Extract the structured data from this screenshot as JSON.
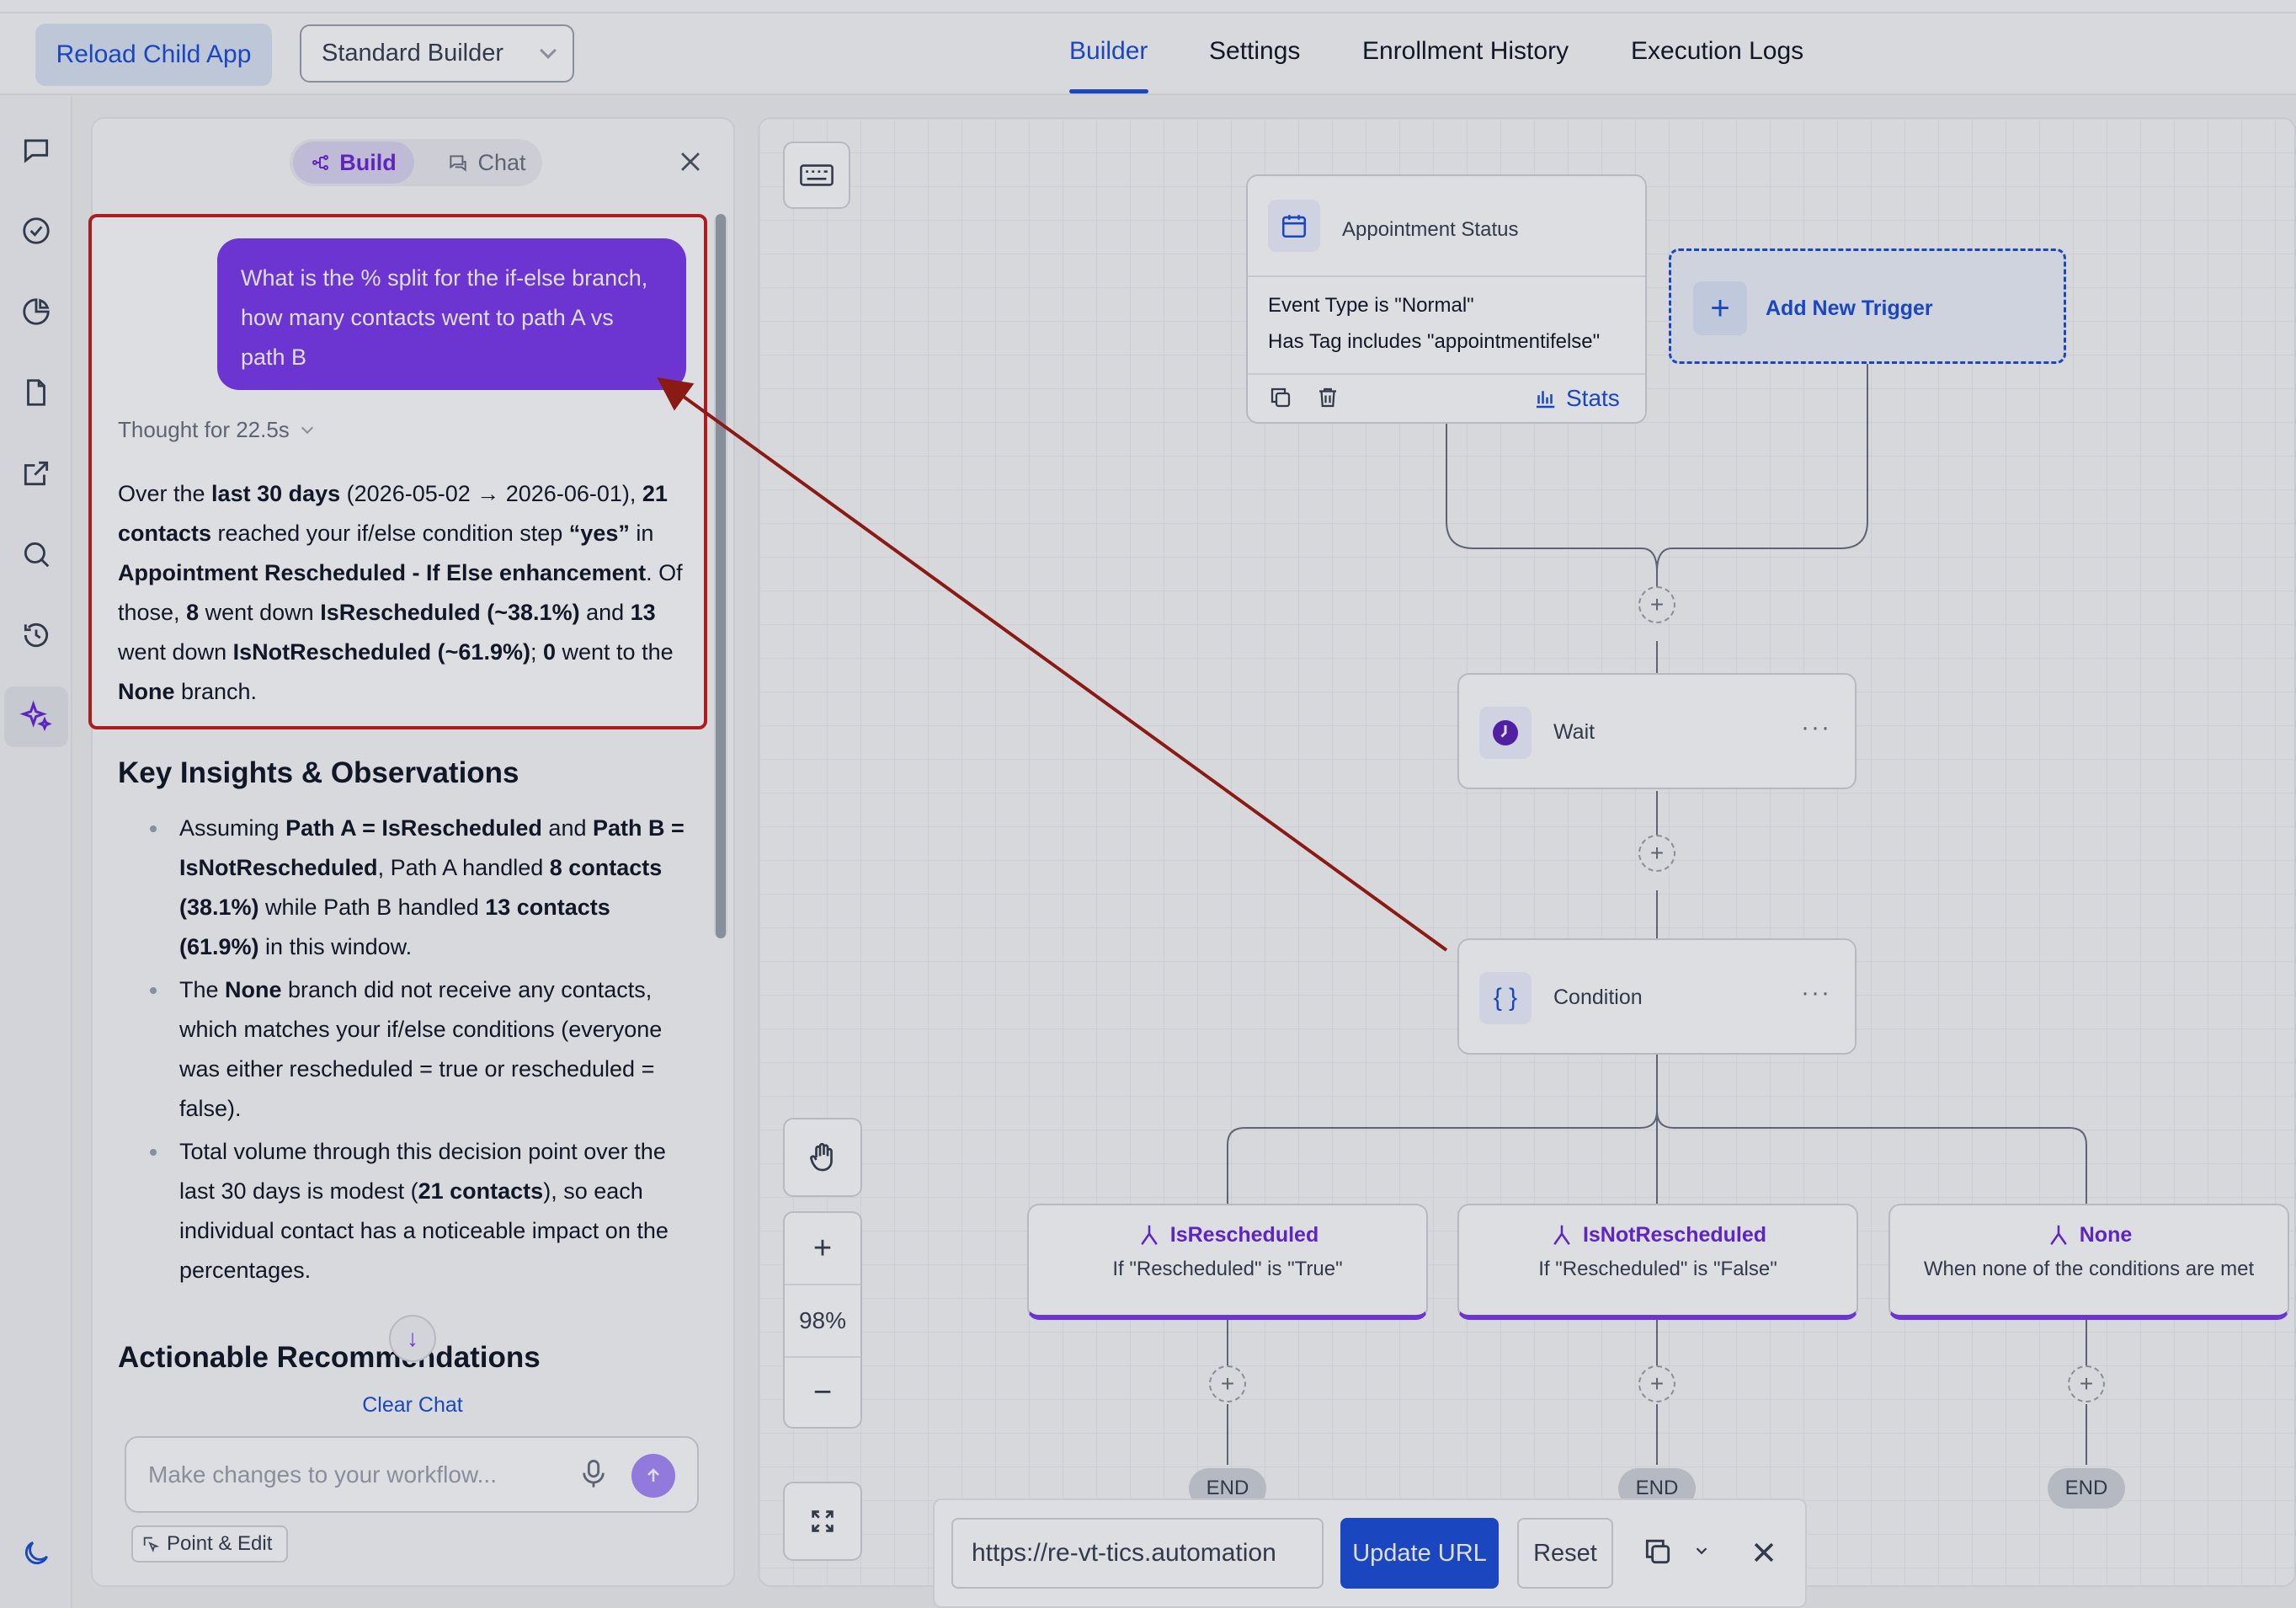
{
  "header": {
    "reload_label": "Reload Child App",
    "builder_select_value": "Standard Builder",
    "tabs": [
      {
        "label": "Builder",
        "active": true
      },
      {
        "label": "Settings"
      },
      {
        "label": "Enrollment History"
      },
      {
        "label": "Execution Logs"
      }
    ]
  },
  "sidebar": {
    "icons": [
      "chat-icon",
      "check-circle-icon",
      "pie-chart-icon",
      "document-icon",
      "external-link-icon",
      "search-icon",
      "history-icon",
      "sparkles-icon",
      "moon-icon"
    ],
    "active": "sparkles-icon"
  },
  "chat_panel": {
    "mode_build": "Build",
    "mode_chat": "Chat",
    "user_message": "What is the % split for the if-else branch, how many contacts went to path A vs path B",
    "thought": "Thought for 22.5s",
    "answer": [
      {
        "t": "Over the "
      },
      {
        "t": "last 30 days",
        "b": true
      },
      {
        "t": " (2026-05-02 → 2026-06-01), "
      },
      {
        "t": "21 contacts",
        "b": true
      },
      {
        "t": " reached your if/else condition step "
      },
      {
        "t": "“yes”",
        "b": true
      },
      {
        "t": " in "
      },
      {
        "t": "Appointment Rescheduled - If Else enhancement",
        "b": true
      },
      {
        "t": ". Of those, "
      },
      {
        "t": "8",
        "b": true
      },
      {
        "t": " went down "
      },
      {
        "t": "IsRescheduled (~38.1%)",
        "b": true
      },
      {
        "t": " and "
      },
      {
        "t": "13",
        "b": true
      },
      {
        "t": " went down "
      },
      {
        "t": "IsNotRescheduled (~61.9%)",
        "b": true
      },
      {
        "t": "; "
      },
      {
        "t": "0",
        "b": true
      },
      {
        "t": " went to the "
      },
      {
        "t": "None",
        "b": true
      },
      {
        "t": " branch."
      }
    ],
    "insights_heading": "Key Insights & Observations",
    "insights": [
      [
        {
          "t": "Assuming "
        },
        {
          "t": "Path A = IsRescheduled",
          "b": true
        },
        {
          "t": " and "
        },
        {
          "t": "Path B = IsNotRescheduled",
          "b": true
        },
        {
          "t": ", Path A handled "
        },
        {
          "t": "8 contacts (38.1%)",
          "b": true
        },
        {
          "t": " while Path B handled "
        },
        {
          "t": "13 contacts (61.9%)",
          "b": true
        },
        {
          "t": " in this window."
        }
      ],
      [
        {
          "t": "The "
        },
        {
          "t": "None",
          "b": true
        },
        {
          "t": " branch did not receive any contacts, which matches your if/else conditions (everyone was either rescheduled = true or rescheduled = false)."
        }
      ],
      [
        {
          "t": "Total volume through this decision point over the last 30 days is modest ("
        },
        {
          "t": "21 contacts",
          "b": true
        },
        {
          "t": "), so each individual contact has a noticeable impact on the percentages."
        }
      ]
    ],
    "recommendations_heading": "Actionable Recommendations",
    "clear_chat": "Clear Chat",
    "input_placeholder": "Make changes to your workflow...",
    "point_edit": "Point & Edit"
  },
  "canvas": {
    "zoom": "98%",
    "trigger": {
      "title": "Appointment Status",
      "filters": [
        "Event Type is \"Normal\"",
        "Has Tag includes \"appointmentifelse\""
      ],
      "stats_label": "Stats"
    },
    "add_trigger": "Add New Trigger",
    "wait_label": "Wait",
    "condition_label": "Condition",
    "branches": [
      {
        "title": "IsRescheduled",
        "subtitle": "If \"Rescheduled\" is \"True\""
      },
      {
        "title": "IsNotRescheduled",
        "subtitle": "If \"Rescheduled\" is \"False\""
      },
      {
        "title": "None",
        "subtitle": "When none of the conditions are met"
      }
    ],
    "end_label": "END"
  },
  "url_bar": {
    "value": "https://re-vt-tics.automation",
    "update_label": "Update URL",
    "reset_label": "Reset"
  },
  "colors": {
    "accent_blue": "#1d4ed8",
    "accent_purple": "#7c3aed",
    "highlight_red": "#c81e1e"
  }
}
